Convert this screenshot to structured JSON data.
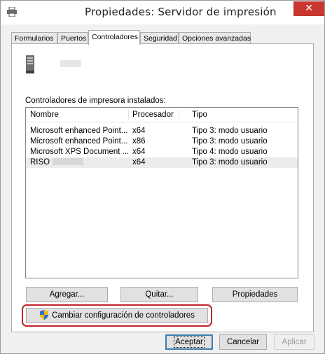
{
  "window": {
    "title": "Propiedades: Servidor de impresión",
    "close_label": "✕"
  },
  "tabs": [
    {
      "label": "Formularios"
    },
    {
      "label": "Puertos"
    },
    {
      "label": "Controladores"
    },
    {
      "label": "Seguridad"
    },
    {
      "label": "Opciones avanzadas"
    }
  ],
  "active_tab": "Controladores",
  "drivers": {
    "section_label": "Controladores de impresora instalados:",
    "columns": [
      "Nombre",
      "Procesador",
      "Tipo"
    ],
    "rows": [
      {
        "name": "Microsoft enhanced Point...",
        "processor": "x64",
        "type": "Tipo 3: modo usuario"
      },
      {
        "name": "Microsoft enhanced Point...",
        "processor": "x86",
        "type": "Tipo 3: modo usuario"
      },
      {
        "name": "Microsoft XPS Document ...",
        "processor": "x64",
        "type": "Tipo 4: modo usuario"
      },
      {
        "name": "RISO",
        "processor": "x64",
        "type": "Tipo 3: modo usuario"
      }
    ]
  },
  "buttons": {
    "add": "Agregar...",
    "remove": "Quitar...",
    "properties": "Propiedades",
    "change_settings": "Cambiar configuración de controladores",
    "accept": "Aceptar",
    "cancel": "Cancelar",
    "apply": "Aplicar"
  },
  "icons": {
    "title": "printer-icon",
    "server": "server-icon",
    "shield": "uac-shield-icon"
  },
  "colors": {
    "close_button": "#c7372f",
    "highlight": "#c1232b",
    "accent_border": "#3c7fb1"
  }
}
